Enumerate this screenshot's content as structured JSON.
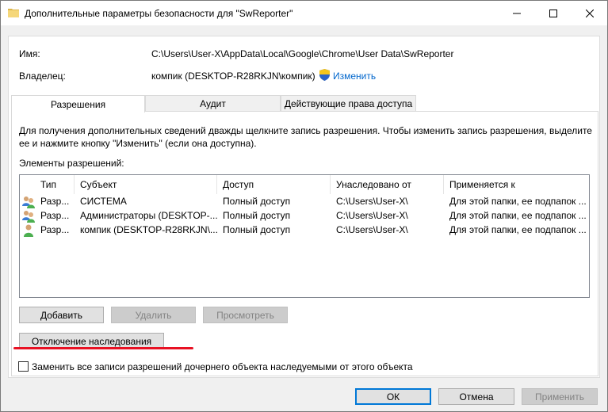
{
  "window": {
    "title": "Дополнительные параметры безопасности  для \"SwReporter\""
  },
  "info": {
    "name_label": "Имя:",
    "name_value": "C:\\Users\\User-X\\AppData\\Local\\Google\\Chrome\\User Data\\SwReporter",
    "owner_label": "Владелец:",
    "owner_value": "компик (DESKTOP-R28RKJN\\компик)",
    "change_link": "Изменить"
  },
  "tabs": [
    {
      "label": "Разрешения",
      "active": true
    },
    {
      "label": "Аудит",
      "active": false
    },
    {
      "label": "Действующие права доступа",
      "active": false
    }
  ],
  "permissions": {
    "description": "Для получения дополнительных сведений дважды щелкните запись разрешения. Чтобы изменить запись разрешения, выделите ее и нажмите кнопку \"Изменить\" (если она доступна).",
    "list_label": "Элементы разрешений:",
    "columns": [
      "Тип",
      "Субъект",
      "Доступ",
      "Унаследовано от",
      "Применяется к"
    ],
    "rows": [
      {
        "type": "Разр...",
        "subject": "СИСТЕМА",
        "access": "Полный доступ",
        "inherited": "C:\\Users\\User-X\\",
        "applies": "Для этой папки, ее подпапок ...",
        "icon": "users-group-icon"
      },
      {
        "type": "Разр...",
        "subject": "Администраторы (DESKTOP-...",
        "access": "Полный доступ",
        "inherited": "C:\\Users\\User-X\\",
        "applies": "Для этой папки, ее подпапок ...",
        "icon": "users-group-icon"
      },
      {
        "type": "Разр...",
        "subject": "компик (DESKTOP-R28RKJN\\...",
        "access": "Полный доступ",
        "inherited": "C:\\Users\\User-X\\",
        "applies": "Для этой папки, ее подпапок ...",
        "icon": "user-icon"
      }
    ]
  },
  "buttons": {
    "add": "Добавить",
    "remove": "Удалить",
    "view": "Просмотреть",
    "disable_inheritance": "Отключение наследования",
    "ok": "ОК",
    "cancel": "Отмена",
    "apply": "Применить"
  },
  "replace_checkbox": {
    "label": "Заменить все записи разрешений дочернего объекта наследуемыми от этого объекта",
    "checked": false
  },
  "colors": {
    "accent": "#0078d7",
    "link": "#0066cc",
    "annotation_underline": "#e81123"
  }
}
